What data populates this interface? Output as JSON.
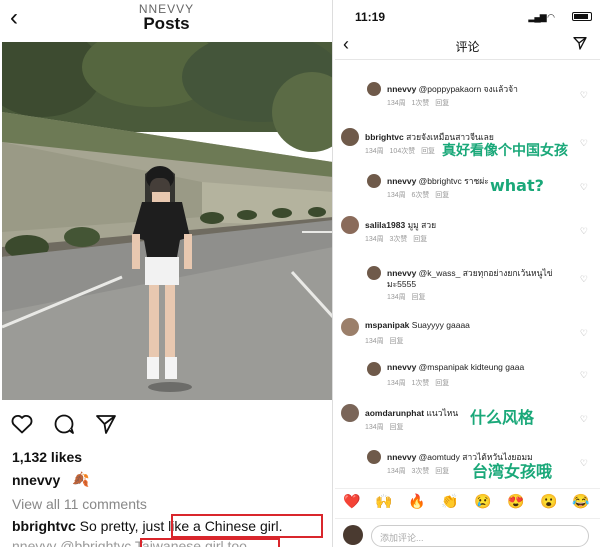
{
  "left": {
    "username": "NNEVVY",
    "title": "Posts",
    "likes": "1,132 likes",
    "caption_user": "nnevvy",
    "caption_emoji": "🍂",
    "view_all": "View all 11 comments",
    "comment1_user": "bbrightvc",
    "comment1_text": "So pretty, just like a Chinese girl.",
    "comment2_text": "nnevvy @bbrightvc Taiwanese girl too"
  },
  "right": {
    "time": "11:19",
    "title": "评论",
    "comments": [
      {
        "user": "nnevvy",
        "text": "@poppypakaorn จงแล้วจ้า",
        "age": "134周",
        "likes": "1次赞",
        "reply": "回复"
      },
      {
        "user": "bbrightvc",
        "text": "สวยจังเหมือนสาวจีนเลย",
        "age": "134周",
        "likes": "104次赞",
        "reply": "回复"
      },
      {
        "user": "nnevvy",
        "text": "@bbrightvc ราชผ่ะ",
        "age": "134周",
        "likes": "6次赞",
        "reply": "回复"
      },
      {
        "user": "salila1983",
        "text": "มูมู สวย",
        "age": "134周",
        "likes": "3次赞",
        "reply": "回复"
      },
      {
        "user": "nnevvy",
        "text": "@k_wass_ สวยทุกอย่างยกเว้นหนูไข่",
        "text2": "มะ5555",
        "age": "134周",
        "likes": "",
        "reply": "回复"
      },
      {
        "user": "mspanipak",
        "text": "Suayyyy gaaaa",
        "age": "134周",
        "likes": "",
        "reply": "回复"
      },
      {
        "user": "nnevvy",
        "text": "@mspanipak kidteung gaaa",
        "age": "134周",
        "likes": "1次赞",
        "reply": "回复"
      },
      {
        "user": "aomdarunphat",
        "text": "แนวไหน",
        "age": "134周",
        "likes": "",
        "reply": "回复"
      },
      {
        "user": "nnevvy",
        "text": "@aomtudy สาวไต้หวันไงยอมม",
        "age": "134周",
        "likes": "3次赞",
        "reply": "回复"
      }
    ],
    "annotations": {
      "a1": "真好看像个中国女孩",
      "a2": "what?",
      "a3": "什么风格",
      "a4": "台湾女孩哦"
    },
    "emojis": [
      "❤️",
      "🙌",
      "🔥",
      "👏",
      "😢",
      "😍",
      "😮",
      "😂"
    ],
    "input_placeholder": "添加评论..."
  },
  "colors": {
    "annotation_green": "#1aa879",
    "highlight_red": "#d9262c"
  }
}
